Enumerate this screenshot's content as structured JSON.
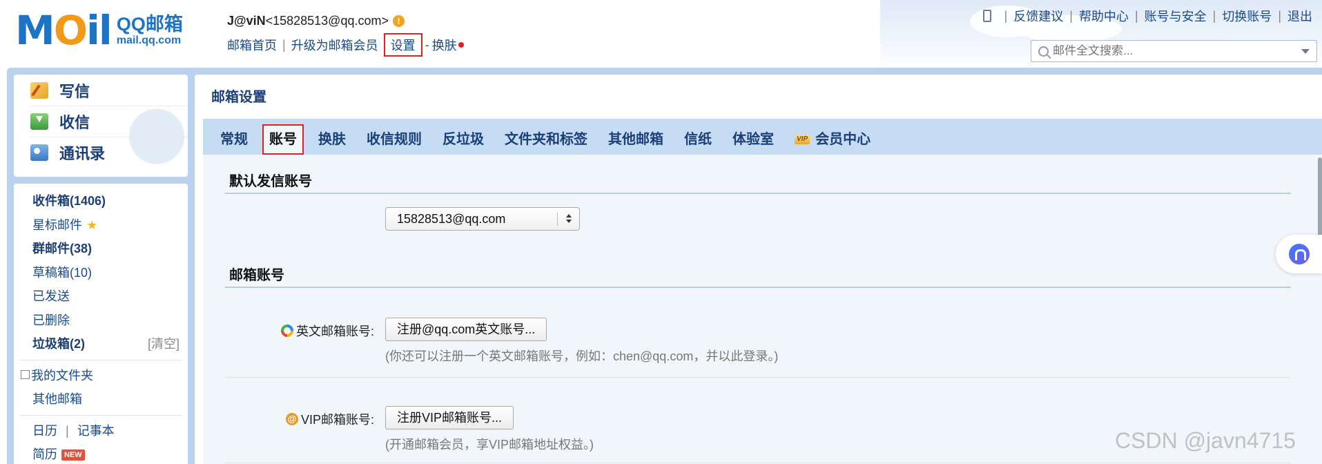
{
  "header": {
    "logo_text": "MOil",
    "logo_brand": "QQ邮箱",
    "logo_url": "mail.qq.com",
    "user_nick": "J@viN",
    "user_email": "<15828513@qq.com>",
    "warn_symbol": "!",
    "nav": {
      "home": "邮箱首页",
      "upgrade": "升级为邮箱会员",
      "settings": "设置",
      "dash": "-",
      "skin": "换肤"
    },
    "right_links": [
      "反馈建议",
      "帮助中心",
      "账号与安全",
      "切换账号",
      "退出"
    ],
    "sep": "|",
    "search_placeholder": "邮件全文搜索..."
  },
  "sidebar": {
    "quick": [
      "写信",
      "收信",
      "通讯录"
    ],
    "folders": {
      "inbox": "收件箱(1406)",
      "starred": "星标邮件",
      "group": "群邮件(38)",
      "drafts": "草稿箱(10)",
      "sent": "已发送",
      "deleted": "已删除",
      "spam": "垃圾箱(2)",
      "spam_clear": "[清空]",
      "my_folders_toggle": "⊞",
      "my_folders": "我的文件夹",
      "other": "其他邮箱",
      "calendar": "日历",
      "calendar_sep": "|",
      "notes": "记事本",
      "resume": "简历",
      "new_badge": "NEW"
    }
  },
  "main": {
    "title": "邮箱设置",
    "tabs": [
      "常规",
      "账号",
      "换肤",
      "收信规则",
      "反垃圾",
      "文件夹和标签",
      "其他邮箱",
      "信纸",
      "体验室",
      "会员中心"
    ],
    "vip_badge": "VIP",
    "section_default": "默认发信账号",
    "default_account": "15828513@qq.com",
    "section_accounts": "邮箱账号",
    "english_label": "英文邮箱账号:",
    "english_button": "注册@qq.com英文账号...",
    "english_hint": "(你还可以注册一个英文邮箱账号，例如：chen@qq.com，并以此登录。)",
    "vip_icon": "@",
    "vip_label": "VIP邮箱账号:",
    "vip_button": "注册VIP邮箱账号...",
    "vip_hint": "(开通邮箱会员，享VIP邮箱地址权益。)"
  },
  "watermark": "CSDN @javn4715",
  "colors": {
    "brand_blue": "#1d74c6",
    "frame_blue": "#b9d3ee",
    "tab_blue": "#c6dcf3",
    "highlight_red": "#e02020"
  }
}
